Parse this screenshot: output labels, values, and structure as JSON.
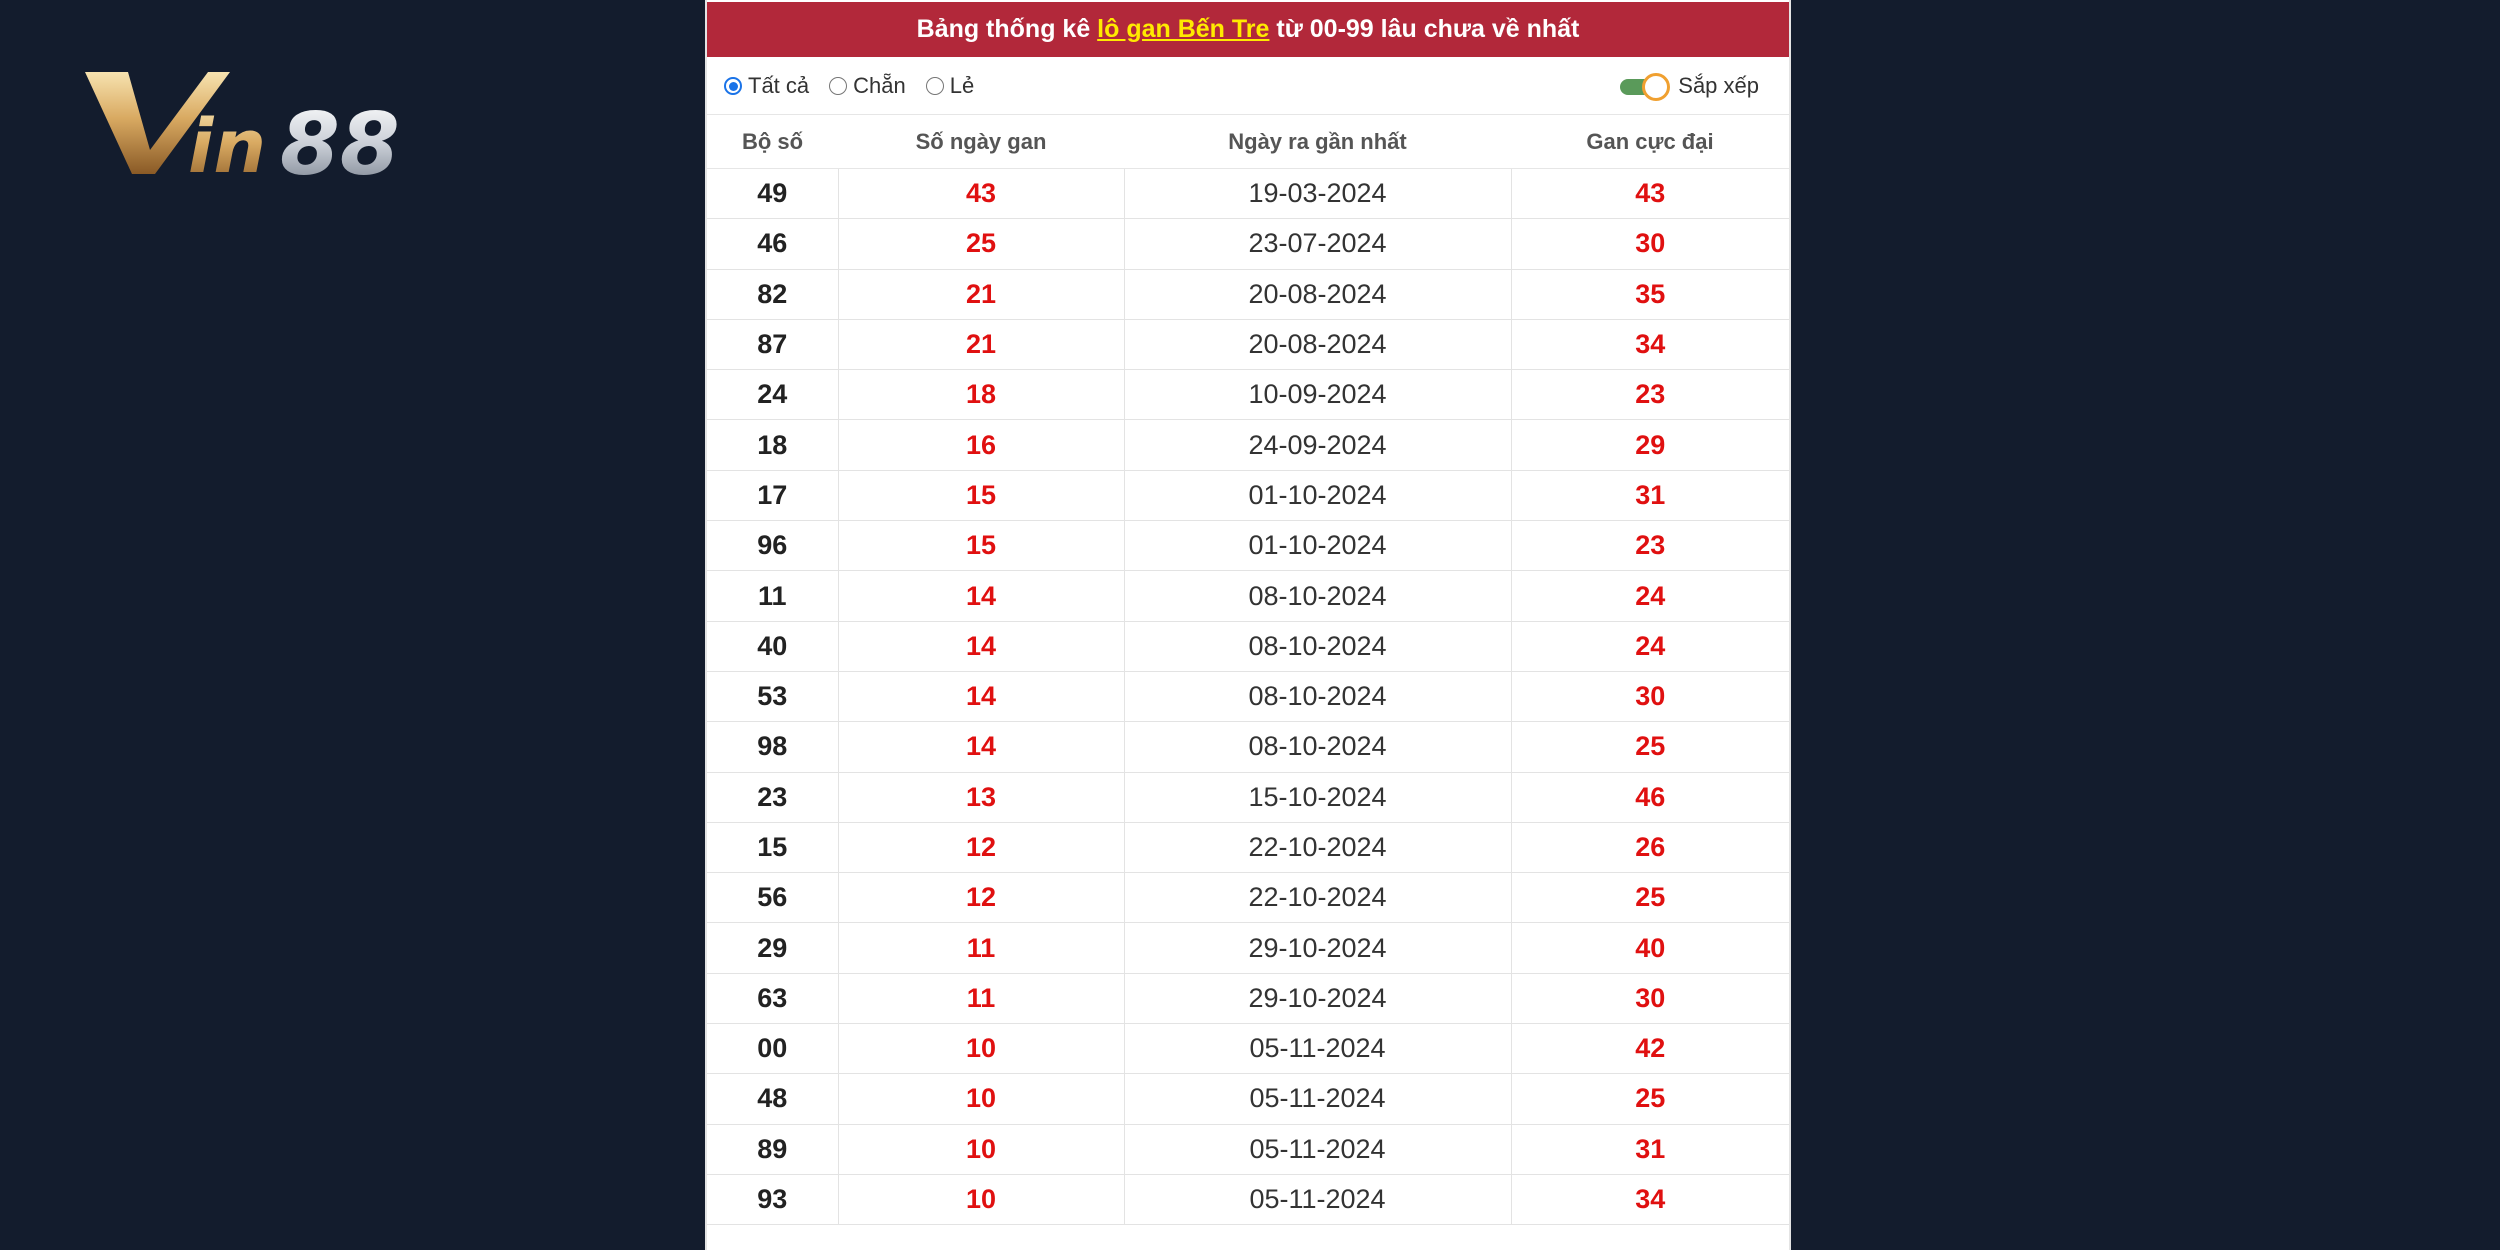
{
  "logo": {
    "text": "Vin88"
  },
  "header": {
    "prefix": "Bảng thống kê ",
    "highlight": "lô gan Bến Tre",
    "suffix": " từ 00-99 lâu chưa về nhất"
  },
  "filters": {
    "options": [
      {
        "label": "Tất cả",
        "checked": true
      },
      {
        "label": "Chẵn",
        "checked": false
      },
      {
        "label": "Lẻ",
        "checked": false
      }
    ],
    "sort_label": "Sắp xếp"
  },
  "table": {
    "headers": [
      "Bộ số",
      "Số ngày gan",
      "Ngày ra gần nhất",
      "Gan cực đại"
    ],
    "rows": [
      {
        "number": "49",
        "days": "43",
        "date": "19-03-2024",
        "max": "43"
      },
      {
        "number": "46",
        "days": "25",
        "date": "23-07-2024",
        "max": "30"
      },
      {
        "number": "82",
        "days": "21",
        "date": "20-08-2024",
        "max": "35"
      },
      {
        "number": "87",
        "days": "21",
        "date": "20-08-2024",
        "max": "34"
      },
      {
        "number": "24",
        "days": "18",
        "date": "10-09-2024",
        "max": "23"
      },
      {
        "number": "18",
        "days": "16",
        "date": "24-09-2024",
        "max": "29"
      },
      {
        "number": "17",
        "days": "15",
        "date": "01-10-2024",
        "max": "31"
      },
      {
        "number": "96",
        "days": "15",
        "date": "01-10-2024",
        "max": "23"
      },
      {
        "number": "11",
        "days": "14",
        "date": "08-10-2024",
        "max": "24"
      },
      {
        "number": "40",
        "days": "14",
        "date": "08-10-2024",
        "max": "24"
      },
      {
        "number": "53",
        "days": "14",
        "date": "08-10-2024",
        "max": "30"
      },
      {
        "number": "98",
        "days": "14",
        "date": "08-10-2024",
        "max": "25"
      },
      {
        "number": "23",
        "days": "13",
        "date": "15-10-2024",
        "max": "46"
      },
      {
        "number": "15",
        "days": "12",
        "date": "22-10-2024",
        "max": "26"
      },
      {
        "number": "56",
        "days": "12",
        "date": "22-10-2024",
        "max": "25"
      },
      {
        "number": "29",
        "days": "11",
        "date": "29-10-2024",
        "max": "40"
      },
      {
        "number": "63",
        "days": "11",
        "date": "29-10-2024",
        "max": "30"
      },
      {
        "number": "00",
        "days": "10",
        "date": "05-11-2024",
        "max": "42"
      },
      {
        "number": "48",
        "days": "10",
        "date": "05-11-2024",
        "max": "25"
      },
      {
        "number": "89",
        "days": "10",
        "date": "05-11-2024",
        "max": "31"
      },
      {
        "number": "93",
        "days": "10",
        "date": "05-11-2024",
        "max": "34"
      }
    ]
  },
  "colors": {
    "background": "#131c2d",
    "header_bg": "#b2283a",
    "highlight": "#ffea00",
    "value_red": "#e01010",
    "radio_blue": "#1a73e8",
    "toggle_green": "#5a9a5a",
    "toggle_orange": "#f0a030"
  }
}
